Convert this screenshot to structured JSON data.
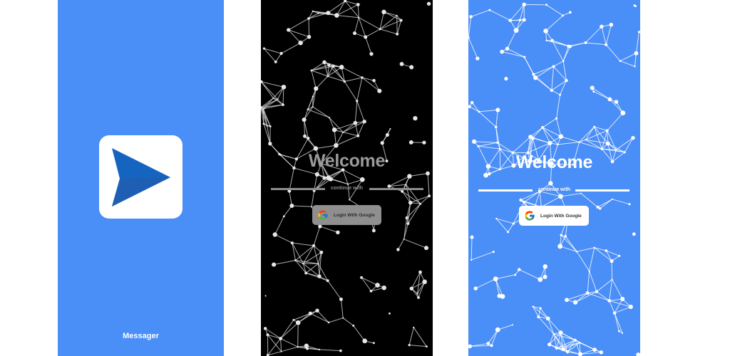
{
  "splash": {
    "app_name": "Messager",
    "icon": "paper-plane-send-icon",
    "background_color": "#4a8ef7",
    "icon_color": "#1565c0"
  },
  "login_dark": {
    "title": "Welcome",
    "divider_text": "continue with",
    "google_button_label": "Login With Google",
    "icon": "google-logo-icon",
    "background_color": "#000000"
  },
  "login_blue": {
    "title": "Welcome",
    "divider_text": "continue with",
    "google_button_label": "Login With Google",
    "icon": "google-logo-icon",
    "background_color": "#4a8ef7"
  }
}
